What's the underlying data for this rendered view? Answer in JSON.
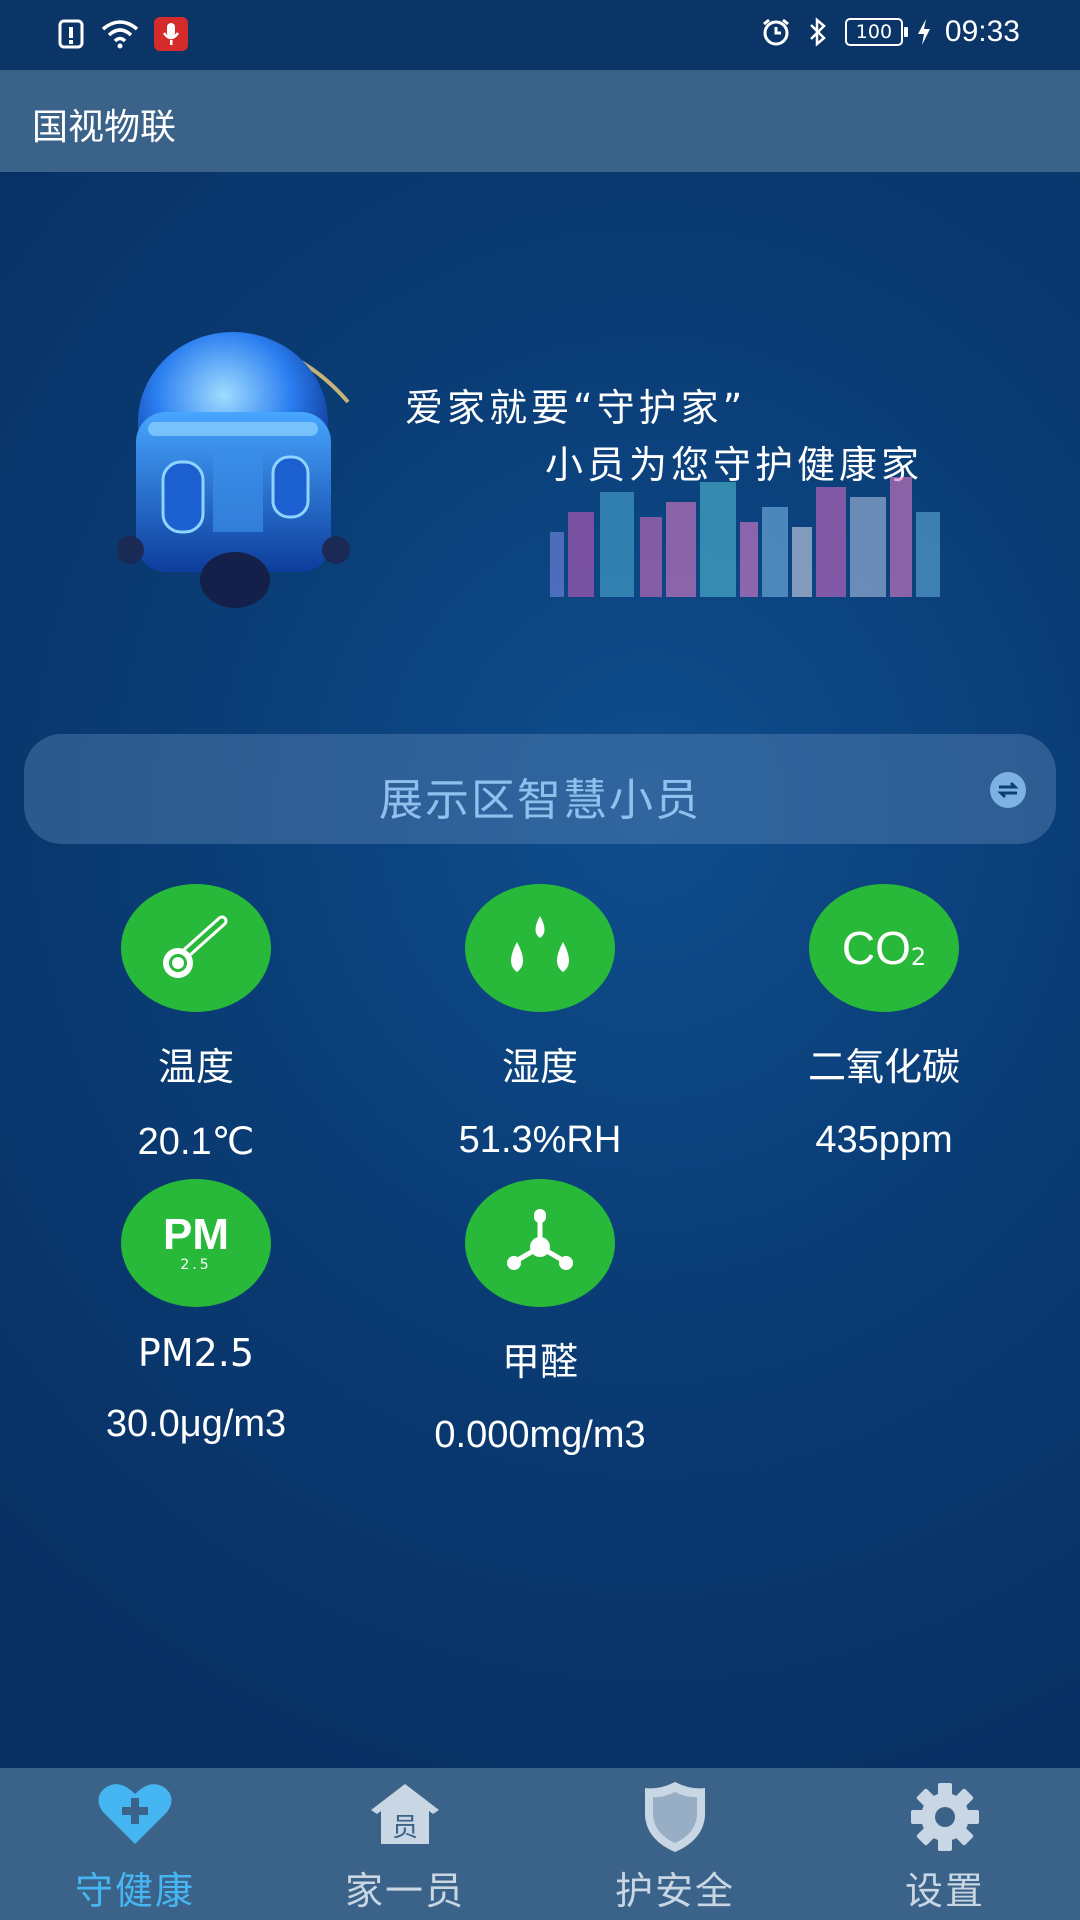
{
  "status_bar": {
    "battery": "100",
    "time": "09:33"
  },
  "app_bar": {
    "title": "国视物联"
  },
  "banner": {
    "slogan_line1": "爱家就要“守护家”",
    "slogan_line2": "小员为您守护健康家"
  },
  "device": {
    "name": "展示区智慧小员"
  },
  "sensors": [
    {
      "label": "温度",
      "value": "20.1℃",
      "icon": "thermometer-icon"
    },
    {
      "label": "湿度",
      "value": "51.3%RH",
      "icon": "humidity-drops-icon"
    },
    {
      "label": "二氧化碳",
      "value": "435ppm",
      "icon": "co2-icon",
      "icon_text": "CO",
      "icon_sub": "2"
    },
    {
      "label": "PM2.5",
      "value": "30.0μg/m3",
      "icon": "pm25-icon",
      "icon_text": "PM",
      "icon_sub": "2.5"
    },
    {
      "label": "甲醛",
      "value": "0.000mg/m3",
      "icon": "molecule-icon"
    }
  ],
  "bottom_nav": [
    {
      "label": "守健康",
      "icon": "heart-plus-icon",
      "active": true
    },
    {
      "label": "家一员",
      "icon": "house-icon",
      "icon_text": "员",
      "active": false
    },
    {
      "label": "护安全",
      "icon": "shield-icon",
      "active": false
    },
    {
      "label": "设置",
      "icon": "gear-icon",
      "active": false
    }
  ],
  "colors": {
    "background": "#0a3d76",
    "bar": "#3b6389",
    "sensor_green": "#28b83a",
    "active_tab": "#46b6f3",
    "device_text": "#8fc0ee"
  }
}
